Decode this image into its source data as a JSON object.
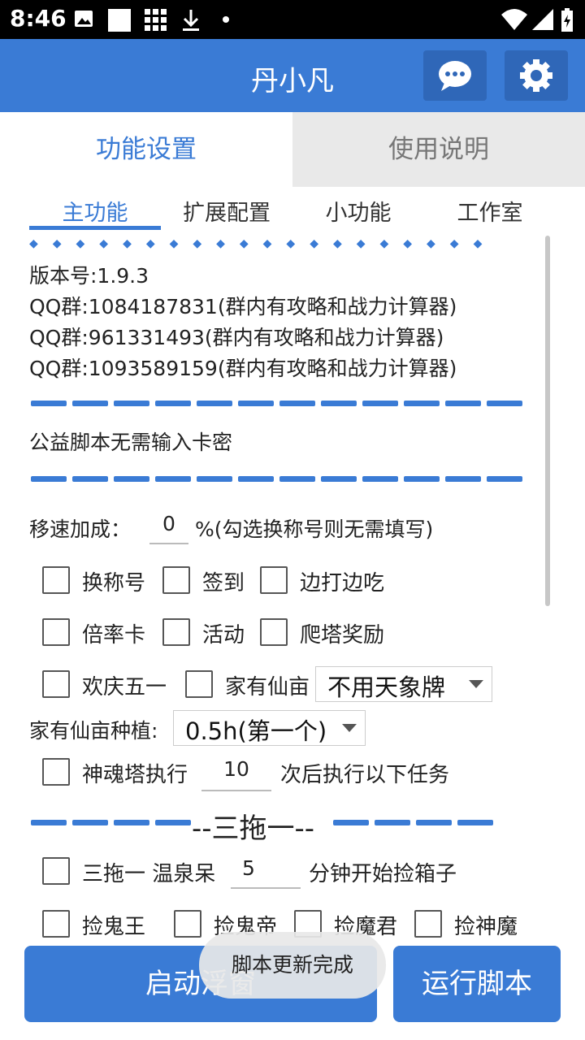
{
  "status_bar": {
    "time": "8:46",
    "left_icons": [
      "image-icon",
      "square-icon",
      "grid-icon",
      "download-icon",
      "dot-icon"
    ],
    "right_icons": [
      "wifi-icon",
      "signal-icon",
      "battery-charging-icon"
    ]
  },
  "app_bar": {
    "title": "丹小凡",
    "icons": [
      "chat-icon",
      "gear-icon"
    ]
  },
  "colors": {
    "accent": "#3a7bd5",
    "accent_dark": "#2f67b8",
    "inactive_tab_bg": "#e9e9e9"
  },
  "main_tabs": [
    {
      "label": "功能设置",
      "active": true
    },
    {
      "label": "使用说明",
      "active": false
    }
  ],
  "sub_tabs": [
    {
      "label": "主功能",
      "active": true
    },
    {
      "label": "扩展配置",
      "active": false
    },
    {
      "label": "小功能",
      "active": false
    },
    {
      "label": "工作室",
      "active": false
    }
  ],
  "info": {
    "diamonds": "◆◆◆◆◆◆◆◆◆◆◆◆◆◆◆◆◆◆◆◆",
    "version": "版本号:1.9.3",
    "qq1": "QQ群:1084187831(群内有攻略和战力计算器)",
    "qq2": "QQ群:961331493(群内有攻略和战力计算器)",
    "qq3": "QQ群:1093589159(群内有攻略和战力计算器)",
    "notice": "公益脚本无需输入卡密"
  },
  "speed": {
    "label": "移速加成：",
    "value": "0",
    "suffix": "%(勾选换称号则无需填写)"
  },
  "checkboxes_row1": [
    "换称号",
    "签到",
    "边打边吃"
  ],
  "checkboxes_row2": [
    "倍率卡",
    "活动",
    "爬塔奖励"
  ],
  "row3": {
    "cb1": "欢庆五一",
    "cb2": "家有仙亩",
    "select": "不用天象牌"
  },
  "plant": {
    "label": "家有仙亩种植:",
    "select": "0.5h(第一个)"
  },
  "tower": {
    "label": "神魂塔执行",
    "value": "10",
    "suffix": "次后执行以下任务"
  },
  "section_title": "--三拖一--",
  "santuo": {
    "label": "三拖一 温泉呆",
    "value": "5",
    "suffix": "分钟开始捡箱子"
  },
  "pick_row": [
    "捡鬼王",
    "捡鬼帝",
    "捡魔君",
    "捡神魔"
  ],
  "buttons": {
    "float": "启动浮窗",
    "run": "运行脚本"
  },
  "toast": "脚本更新完成"
}
